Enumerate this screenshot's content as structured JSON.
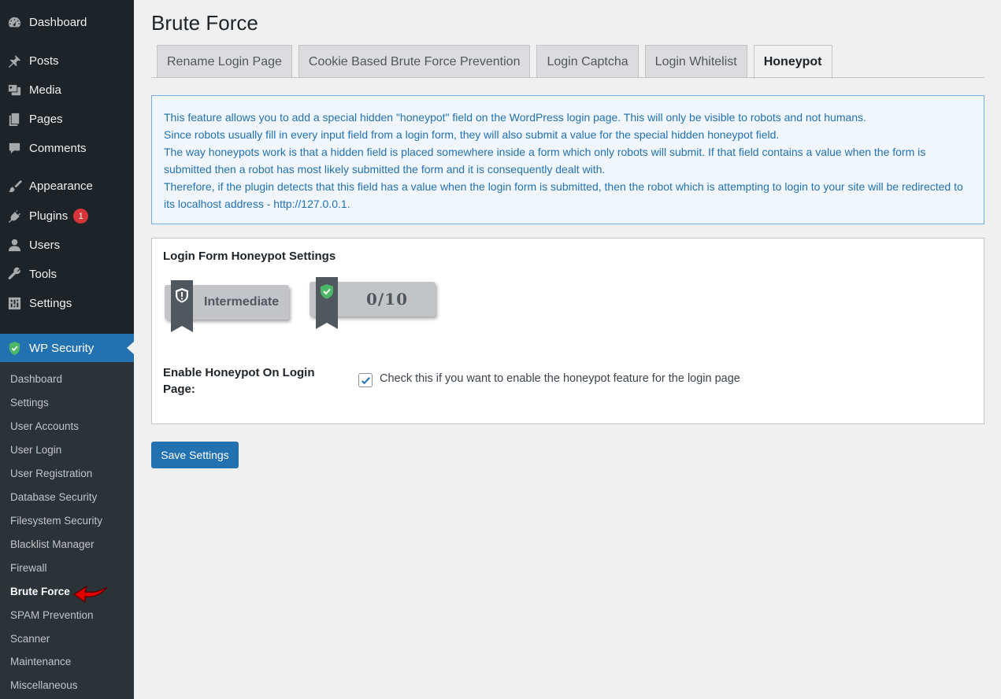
{
  "sidebar": {
    "menu": [
      {
        "label": "Dashboard",
        "icon": "dashboard-icon"
      },
      {
        "label": "Posts",
        "icon": "pin-icon"
      },
      {
        "label": "Media",
        "icon": "media-icon"
      },
      {
        "label": "Pages",
        "icon": "pages-icon"
      },
      {
        "label": "Comments",
        "icon": "comment-icon"
      },
      {
        "label": "Appearance",
        "icon": "paintbrush-icon"
      },
      {
        "label": "Plugins",
        "icon": "plugin-icon",
        "badge": "1"
      },
      {
        "label": "Users",
        "icon": "user-icon"
      },
      {
        "label": "Tools",
        "icon": "wrench-icon"
      },
      {
        "label": "Settings",
        "icon": "settings-icon"
      }
    ],
    "active": {
      "label": "WP Security",
      "icon": "shield-icon"
    },
    "submenu": [
      "Dashboard",
      "Settings",
      "User Accounts",
      "User Login",
      "User Registration",
      "Database Security",
      "Filesystem Security",
      "Blacklist Manager",
      "Firewall",
      "Brute Force",
      "SPAM Prevention",
      "Scanner",
      "Maintenance",
      "Miscellaneous"
    ],
    "current_submenu": "Brute Force"
  },
  "page": {
    "title": "Brute Force",
    "tabs": [
      "Rename Login Page",
      "Cookie Based Brute Force Prevention",
      "Login Captcha",
      "Login Whitelist",
      "Honeypot"
    ],
    "active_tab": "Honeypot"
  },
  "info": [
    "This feature allows you to add a special hidden \"honeypot\" field on the WordPress login page. This will only be visible to robots and not humans.",
    "Since robots usually fill in every input field from a login form, they will also submit a value for the special hidden honeypot field.",
    "The way honeypots work is that a hidden field is placed somewhere inside a form which only robots will submit. If that field contains a value when the form is submitted then a robot has most likely submitted the form and it is consequently dealt with.",
    "Therefore, if the plugin detects that this field has a value when the login form is submitted, then the robot which is attempting to login to your site will be redirected to its localhost address - http://127.0.0.1."
  ],
  "settings": {
    "title": "Login Form Honeypot Settings",
    "level": "Intermediate",
    "score": "0/10",
    "field_label": "Enable Honeypot On Login Page:",
    "checkbox_checked": true,
    "checkbox_desc": "Check this if you want to enable the honeypot feature for the login page"
  },
  "save_label": "Save Settings",
  "colors": {
    "sidebar_bg": "#1d2327",
    "submenu_bg": "#2c3338",
    "accent": "#2271b1",
    "notice_bg": "#f0f6fc",
    "badge": "#d63638",
    "arrow": "#e00000"
  }
}
